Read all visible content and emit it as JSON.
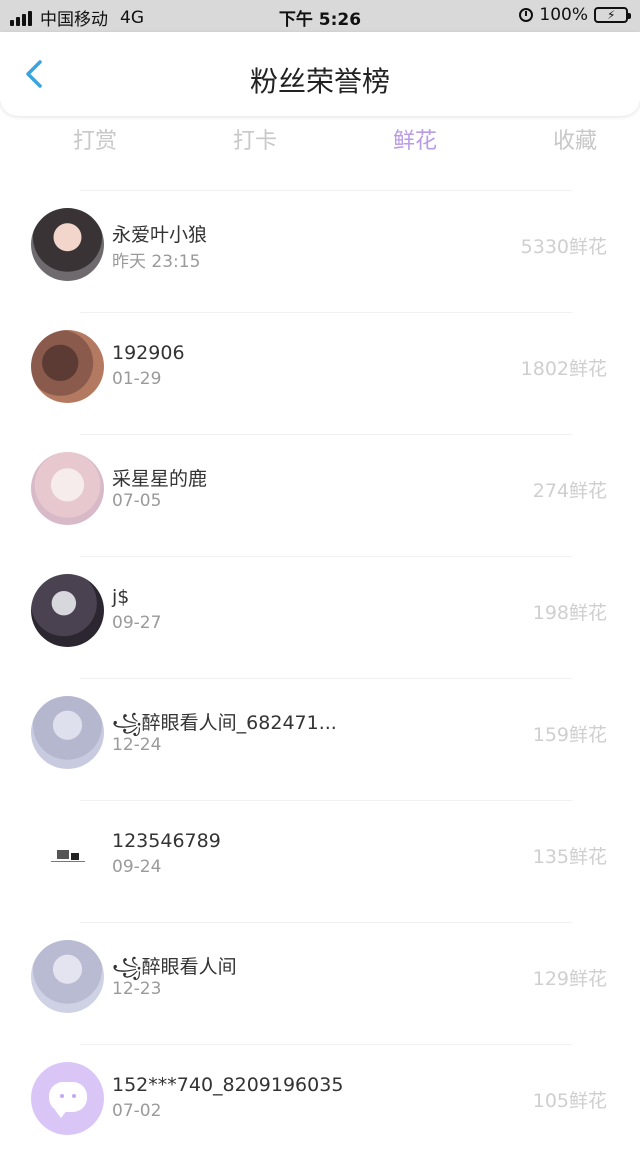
{
  "status_bar": {
    "carrier": "中国移动",
    "network": "4G",
    "time": "下午 5:26",
    "battery": "100%"
  },
  "header": {
    "title": "粉丝荣誉榜"
  },
  "tabs": [
    {
      "label": "打赏",
      "active": false
    },
    {
      "label": "打卡",
      "active": false
    },
    {
      "label": "鲜花",
      "active": true
    },
    {
      "label": "收藏",
      "active": false
    }
  ],
  "fans": [
    {
      "name": "永爱叶小狼",
      "date": "昨天 23:15",
      "count": "5330鲜花"
    },
    {
      "name": "192906",
      "date": "01-29",
      "count": "1802鲜花"
    },
    {
      "name": "采星星的鹿",
      "date": "07-05",
      "count": "274鲜花"
    },
    {
      "name": "j$",
      "date": "09-27",
      "count": "198鲜花"
    },
    {
      "name": "꧁醉眼看人间_682471...",
      "date": "12-24",
      "count": "159鲜花"
    },
    {
      "name": "123546789",
      "date": "09-24",
      "count": "135鲜花"
    },
    {
      "name": "꧁醉眼看人间",
      "date": "12-23",
      "count": "129鲜花"
    },
    {
      "name": "152***740_8209196035",
      "date": "07-02",
      "count": "105鲜花"
    }
  ],
  "colors": {
    "accent": "#b99be6",
    "back_arrow": "#3aa3e0",
    "battery_green": "#4cd964"
  }
}
